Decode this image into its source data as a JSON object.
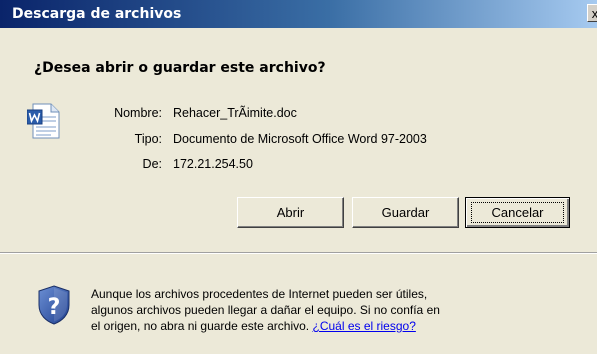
{
  "window": {
    "title": "Descarga de archivos",
    "close_label": "x"
  },
  "question": "¿Desea abrir o guardar este archivo?",
  "file_info": {
    "name_label": "Nombre:",
    "name_value": "Rehacer_TrÃimite.doc",
    "type_label": "Tipo:",
    "type_value": "Documento de Microsoft Office Word 97-2003",
    "from_label": "De:",
    "from_value": "172.21.254.50",
    "icon": "word-document-icon"
  },
  "buttons": {
    "open_label": "Abrir",
    "save_label": "Guardar",
    "cancel_label": "Cancelar"
  },
  "warning": {
    "icon": "shield-question-icon",
    "line1": "Aunque los archivos procedentes de Internet pueden ser útiles,",
    "line2": "algunos archivos pueden llegar a dañar el equipo. Si no confía en",
    "line3": "el origen, no abra ni guarde este archivo.",
    "risk_link": "¿Cuál es el riesgo?"
  },
  "colors": {
    "titlebar_start": "#0a246a",
    "titlebar_end": "#a6caf0",
    "dialog_background": "#ece9d8",
    "link": "#0000ee"
  }
}
